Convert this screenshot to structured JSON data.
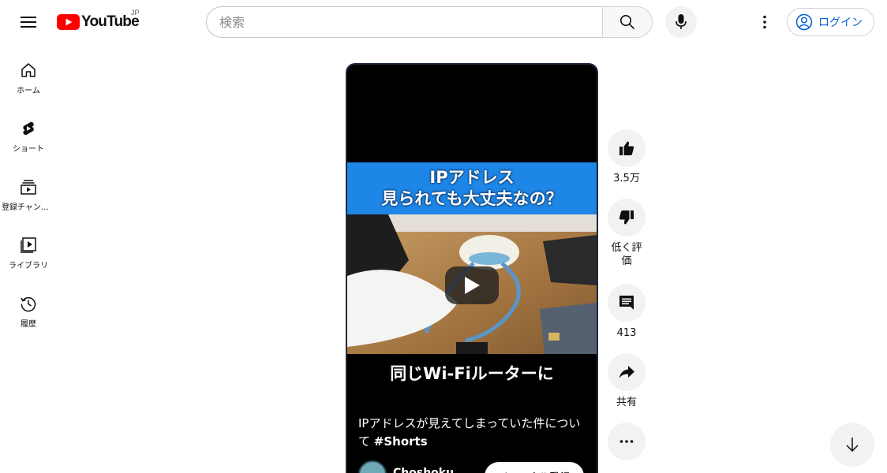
{
  "header": {
    "logo_text": "YouTube",
    "logo_country": "JP",
    "search_placeholder": "検索",
    "login_label": "ログイン"
  },
  "sidebar": {
    "items": [
      {
        "label": "ホーム",
        "icon": "home-icon"
      },
      {
        "label": "ショート",
        "icon": "shorts-icon"
      },
      {
        "label": "登録チャンネル",
        "icon": "subscriptions-icon"
      },
      {
        "label": "ライブラリ",
        "icon": "library-icon"
      },
      {
        "label": "履歴",
        "icon": "history-icon"
      }
    ]
  },
  "video": {
    "banner_line1": "IPアドレス",
    "banner_line2": "見られても大丈夫なの？",
    "caption": "同じWi-Fiルーターに",
    "title_text": "IPアドレスが見えてしまっていた件について ",
    "title_tag": "#Shorts",
    "channel_name": "Choshoku",
    "subscribe_label": "チャンネル登録"
  },
  "actions": {
    "like_count": "3.5万",
    "dislike_label": "低く評価",
    "comment_count": "413",
    "share_label": "共有"
  },
  "colors": {
    "brand_red": "#ff0000",
    "link_blue": "#065fd4",
    "banner_blue": "#1d86e6"
  }
}
